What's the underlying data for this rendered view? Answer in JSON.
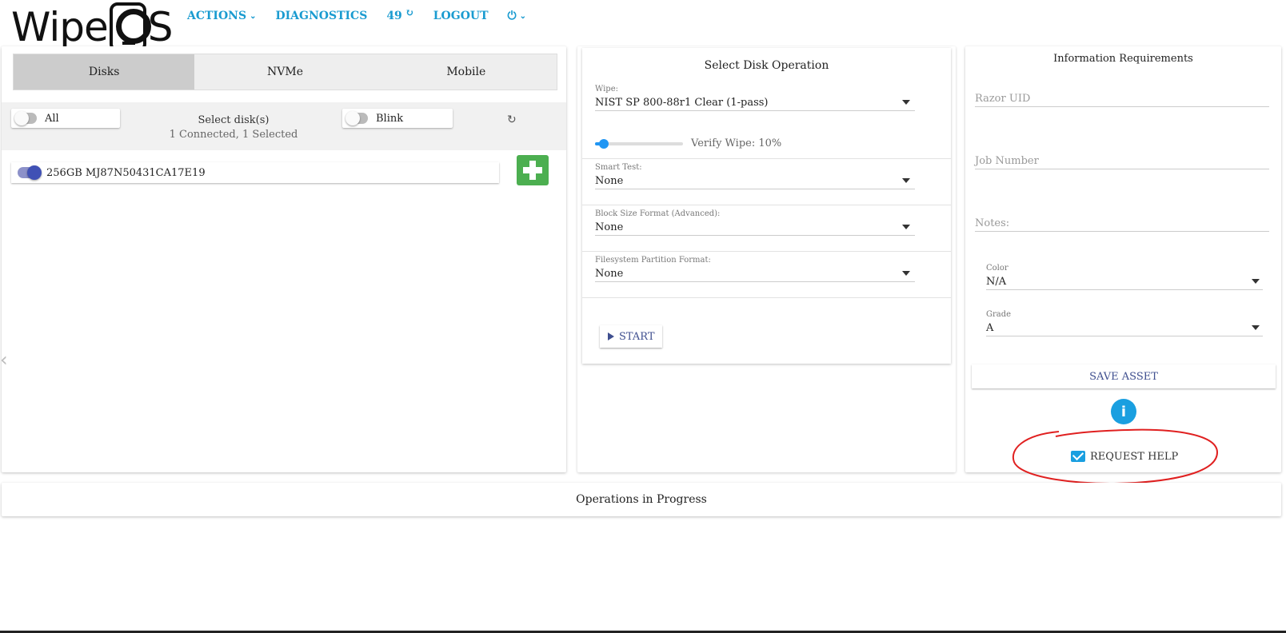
{
  "header": {
    "logo_left": "Wipe",
    "logo_right": "S",
    "nav": {
      "actions": "ACTIONS",
      "diagnostics": "DIAGNOSTICS",
      "count": "49",
      "logout": "LOGOUT"
    },
    "icons": [
      "chevron-down-icon",
      "refresh-icon",
      "power-icon"
    ]
  },
  "disks_panel": {
    "tabs": [
      "Disks",
      "NVMe",
      "Mobile"
    ],
    "active_tab": "Disks",
    "all_label": "All",
    "blink_label": "Blink",
    "select_title": "Select disk(s)",
    "select_status": "1 Connected, 1 Selected",
    "disks": [
      {
        "label": "256GB MJ87N50431CA17E19",
        "selected": true
      }
    ]
  },
  "operation_panel": {
    "title": "Select Disk Operation",
    "wipe": {
      "label": "Wipe:",
      "value": "NIST SP 800-88r1 Clear (1-pass)"
    },
    "verify": {
      "label": "Verify Wipe: 10%",
      "percent": 10
    },
    "smart_test": {
      "label": "Smart Test:",
      "value": "None"
    },
    "block_size": {
      "label": "Block Size Format (Advanced):",
      "value": "None"
    },
    "partition": {
      "label": "Filesystem Partition Format:",
      "value": "None"
    },
    "start": "START"
  },
  "info_panel": {
    "title": "Information Requirements",
    "razor_uid": "Razor UID",
    "job_number": "Job Number",
    "notes": "Notes:",
    "color": {
      "label": "Color",
      "value": "N/A"
    },
    "grade": {
      "label": "Grade",
      "value": "A"
    },
    "save": "SAVE ASSET",
    "request_help": "REQUEST HELP"
  },
  "operations": {
    "title": "Operations in Progress"
  },
  "colors": {
    "accent": "#1a9bd0",
    "add_button": "#4caf50",
    "annotation": "#e02020"
  }
}
